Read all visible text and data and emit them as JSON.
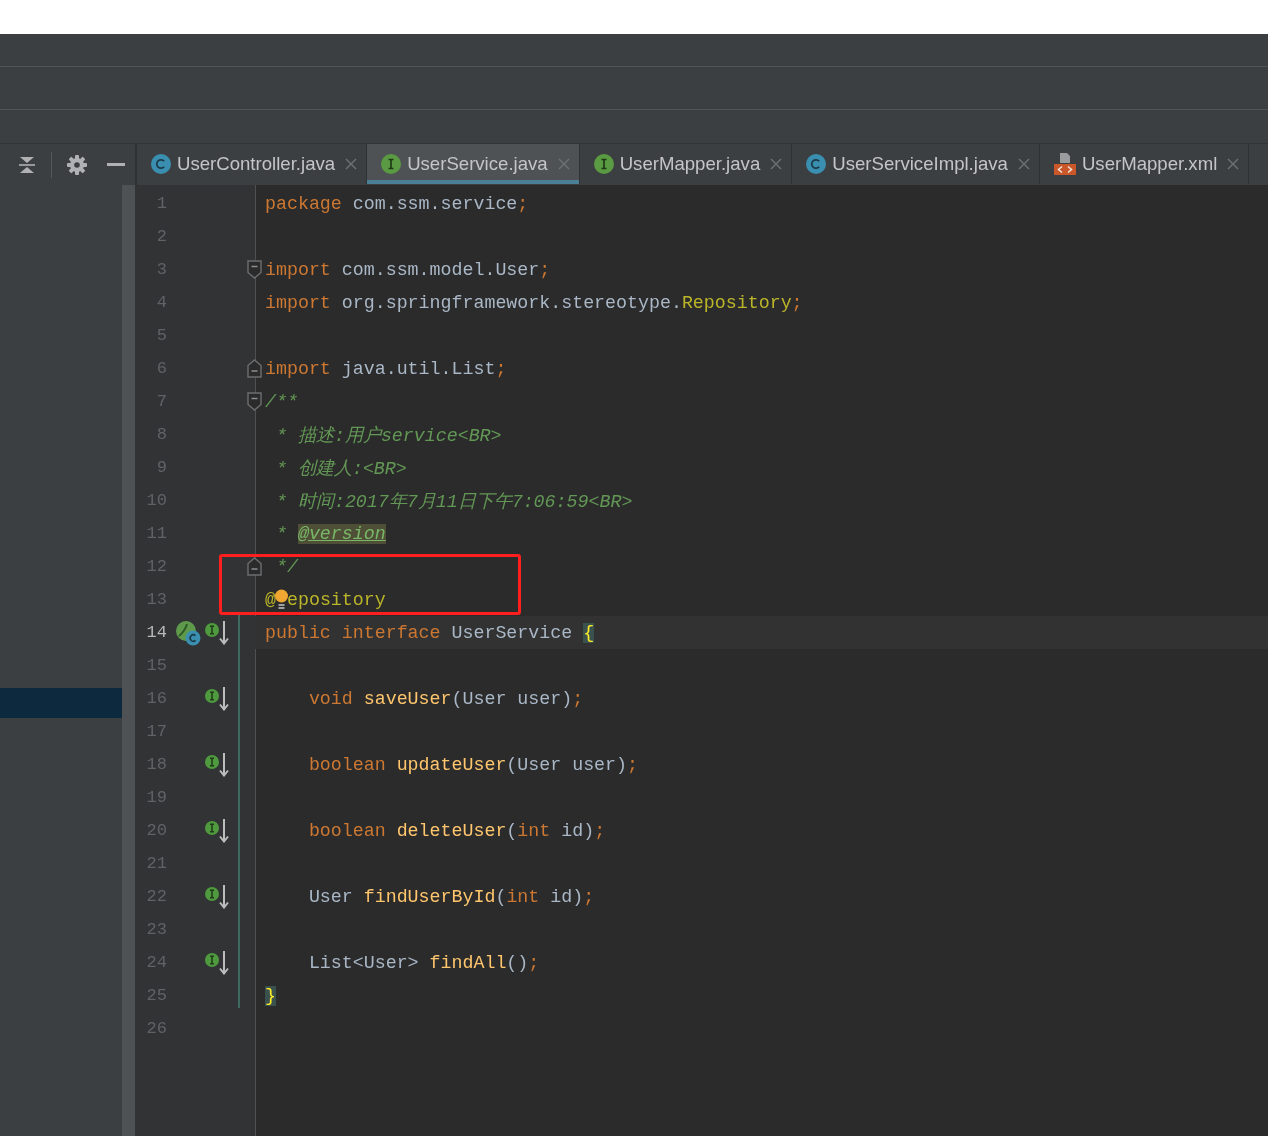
{
  "editor_tabs": [
    {
      "label": "UserController.java",
      "kind": "class",
      "selected": false
    },
    {
      "label": "UserService.java",
      "kind": "interface",
      "selected": true
    },
    {
      "label": "UserMapper.java",
      "kind": "interface",
      "selected": false
    },
    {
      "label": "UserServiceImpl.java",
      "kind": "class",
      "selected": false
    },
    {
      "label": "UserMapper.xml",
      "kind": "xml",
      "selected": false
    }
  ],
  "editor": {
    "lines": [
      {
        "number": "1",
        "current": false,
        "tokens": [
          {
            "text": "package",
            "kind": "keyword"
          },
          {
            "text": " com.ssm.service",
            "kind": "plain"
          },
          {
            "text": ";",
            "kind": "punct"
          }
        ]
      },
      {
        "number": "2",
        "current": false
      },
      {
        "number": "3",
        "current": false,
        "gutter_icons": [
          {
            "kind": "fold_start"
          }
        ],
        "tokens": [
          {
            "text": "import",
            "kind": "keyword"
          },
          {
            "text": " com.ssm.model.User",
            "kind": "plain"
          },
          {
            "text": ";",
            "kind": "punct"
          }
        ]
      },
      {
        "number": "4",
        "current": false,
        "tokens": [
          {
            "text": "import",
            "kind": "keyword"
          },
          {
            "text": " org.springframework.stereotype.",
            "kind": "plain"
          },
          {
            "text": "Repository",
            "kind": "annotation"
          },
          {
            "text": ";",
            "kind": "punct"
          }
        ]
      },
      {
        "number": "5",
        "current": false
      },
      {
        "number": "6",
        "current": false,
        "gutter_icons": [
          {
            "kind": "fold_end"
          }
        ],
        "tokens": [
          {
            "text": "import",
            "kind": "keyword"
          },
          {
            "text": " java.util.List",
            "kind": "plain"
          },
          {
            "text": ";",
            "kind": "punct"
          }
        ]
      },
      {
        "number": "7",
        "current": false,
        "gutter_icons": [
          {
            "kind": "fold_start"
          }
        ],
        "tokens": [
          {
            "text": "/**",
            "kind": "doc"
          }
        ]
      },
      {
        "number": "8",
        "current": false,
        "tokens": [
          {
            "text": " * 描述:用户service<BR>",
            "kind": "doc"
          }
        ]
      },
      {
        "number": "9",
        "current": false,
        "tokens": [
          {
            "text": " * 创建人:<BR>",
            "kind": "doc"
          }
        ]
      },
      {
        "number": "10",
        "current": false,
        "tokens": [
          {
            "text": " * 时间:2017年7月11日下午7:06:59<BR>",
            "kind": "doc"
          }
        ]
      },
      {
        "number": "11",
        "current": false,
        "tokens": [
          {
            "text": " * ",
            "kind": "doc"
          },
          {
            "text": "@version",
            "kind": "doc_tag"
          }
        ]
      },
      {
        "number": "12",
        "current": false,
        "gutter_icons": [
          {
            "kind": "fold_end"
          }
        ],
        "tokens": [
          {
            "text": " */",
            "kind": "doc"
          }
        ]
      },
      {
        "number": "13",
        "current": false,
        "tokens": [
          {
            "text": "@",
            "kind": "annotation"
          },
          {
            "kind": "bulb"
          },
          {
            "text": "epository",
            "kind": "annotation"
          }
        ]
      },
      {
        "number": "14",
        "current": true,
        "gutter_icons": [
          {
            "kind": "spring_bean"
          },
          {
            "kind": "implemented"
          }
        ],
        "tokens": [
          {
            "text": "public interface",
            "kind": "keyword"
          },
          {
            "text": " UserService ",
            "kind": "plain"
          },
          {
            "text": "{",
            "kind": "brace"
          }
        ]
      },
      {
        "number": "15",
        "current": false
      },
      {
        "number": "16",
        "current": false,
        "gutter_icons": [
          {
            "kind": "implemented"
          }
        ],
        "tokens": [
          {
            "text": "    void",
            "kind": "keyword"
          },
          {
            "text": " saveUser",
            "kind": "method"
          },
          {
            "text": "(User user)",
            "kind": "plain"
          },
          {
            "text": ";",
            "kind": "punct"
          }
        ]
      },
      {
        "number": "17",
        "current": false
      },
      {
        "number": "18",
        "current": false,
        "gutter_icons": [
          {
            "kind": "implemented"
          }
        ],
        "tokens": [
          {
            "text": "    boolean",
            "kind": "keyword"
          },
          {
            "text": " updateUser",
            "kind": "method"
          },
          {
            "text": "(User user)",
            "kind": "plain"
          },
          {
            "text": ";",
            "kind": "punct"
          }
        ]
      },
      {
        "number": "19",
        "current": false
      },
      {
        "number": "20",
        "current": false,
        "gutter_icons": [
          {
            "kind": "implemented"
          }
        ],
        "tokens": [
          {
            "text": "    boolean",
            "kind": "keyword"
          },
          {
            "text": " deleteUser",
            "kind": "method"
          },
          {
            "text": "(",
            "kind": "plain"
          },
          {
            "text": "int",
            "kind": "keyword"
          },
          {
            "text": " id)",
            "kind": "plain"
          },
          {
            "text": ";",
            "kind": "punct"
          }
        ]
      },
      {
        "number": "21",
        "current": false
      },
      {
        "number": "22",
        "current": false,
        "gutter_icons": [
          {
            "kind": "implemented"
          }
        ],
        "tokens": [
          {
            "text": "    User",
            "kind": "plain"
          },
          {
            "text": " findUserById",
            "kind": "method"
          },
          {
            "text": "(",
            "kind": "plain"
          },
          {
            "text": "int",
            "kind": "keyword"
          },
          {
            "text": " id)",
            "kind": "plain"
          },
          {
            "text": ";",
            "kind": "punct"
          }
        ]
      },
      {
        "number": "23",
        "current": false
      },
      {
        "number": "24",
        "current": false,
        "gutter_icons": [
          {
            "kind": "implemented"
          }
        ],
        "tokens": [
          {
            "text": "    List<User>",
            "kind": "plain"
          },
          {
            "text": " findAll",
            "kind": "method"
          },
          {
            "text": "()",
            "kind": "plain"
          },
          {
            "text": ";",
            "kind": "punct"
          }
        ]
      },
      {
        "number": "25",
        "current": false,
        "tokens": [
          {
            "text": "}",
            "kind": "brace"
          }
        ]
      },
      {
        "number": "26",
        "current": false
      }
    ]
  }
}
